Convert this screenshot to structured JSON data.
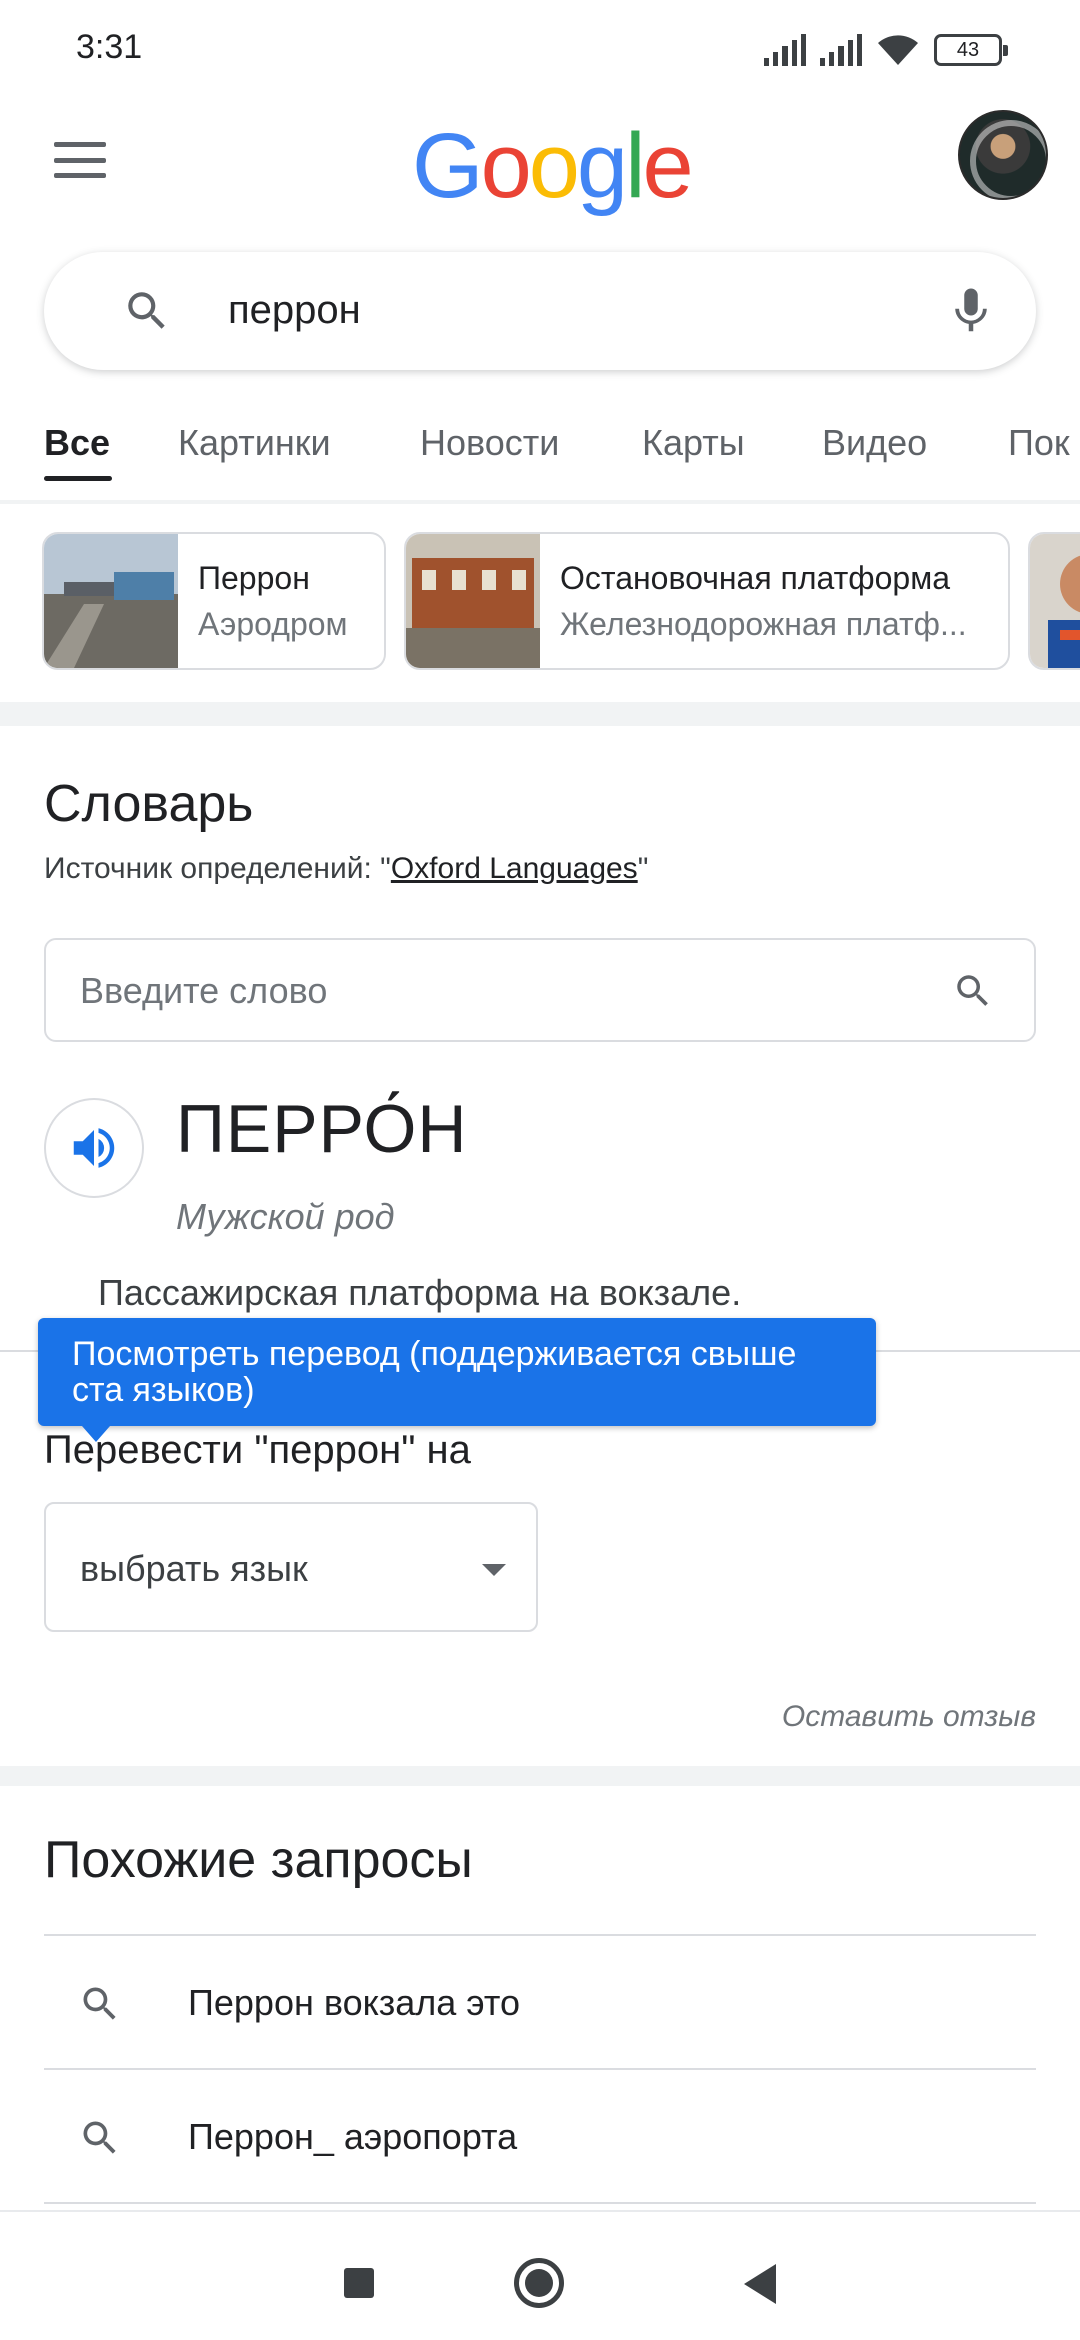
{
  "status_bar": {
    "time": "3:31",
    "battery": "43"
  },
  "header": {
    "logo": [
      "G",
      "o",
      "o",
      "g",
      "l",
      "e"
    ],
    "logo_colors": [
      "#4285f4",
      "#ea4335",
      "#fbbc05",
      "#4285f4",
      "#34a853",
      "#ea4335"
    ]
  },
  "search": {
    "query": "перрон"
  },
  "tabs": [
    {
      "label": "Все",
      "active": true
    },
    {
      "label": "Картинки"
    },
    {
      "label": "Новости"
    },
    {
      "label": "Карты"
    },
    {
      "label": "Видео"
    },
    {
      "label": "Пок"
    }
  ],
  "chips": [
    {
      "title": "Перрон",
      "subtitle": "Аэродром"
    },
    {
      "title": "Остановочная платформа",
      "subtitle": "Железнодорожная платф..."
    }
  ],
  "dictionary": {
    "title": "Словарь",
    "source_prefix": "Источник определений: \"",
    "source_link": "Oxford Languages",
    "source_suffix": "\"",
    "input_placeholder": "Введите слово",
    "headword": "ПЕРРО́Н",
    "gender": "Мужской род",
    "definition": "Пассажирская платформа на вокзале.",
    "tooltip": "Посмотреть перевод (поддерживается свыше ста языков)",
    "translate_label": "Перевести \"перрон\" на",
    "language_select": "выбрать язык",
    "feedback": "Оставить отзыв"
  },
  "related": {
    "title": "Похожие запросы",
    "items": [
      "Перрон вокзала это",
      "Перрон_ аэропорта"
    ]
  },
  "colors": {
    "accent": "#1a73e8",
    "text": "#202124",
    "muted": "#70757a",
    "border": "#dadce0"
  }
}
